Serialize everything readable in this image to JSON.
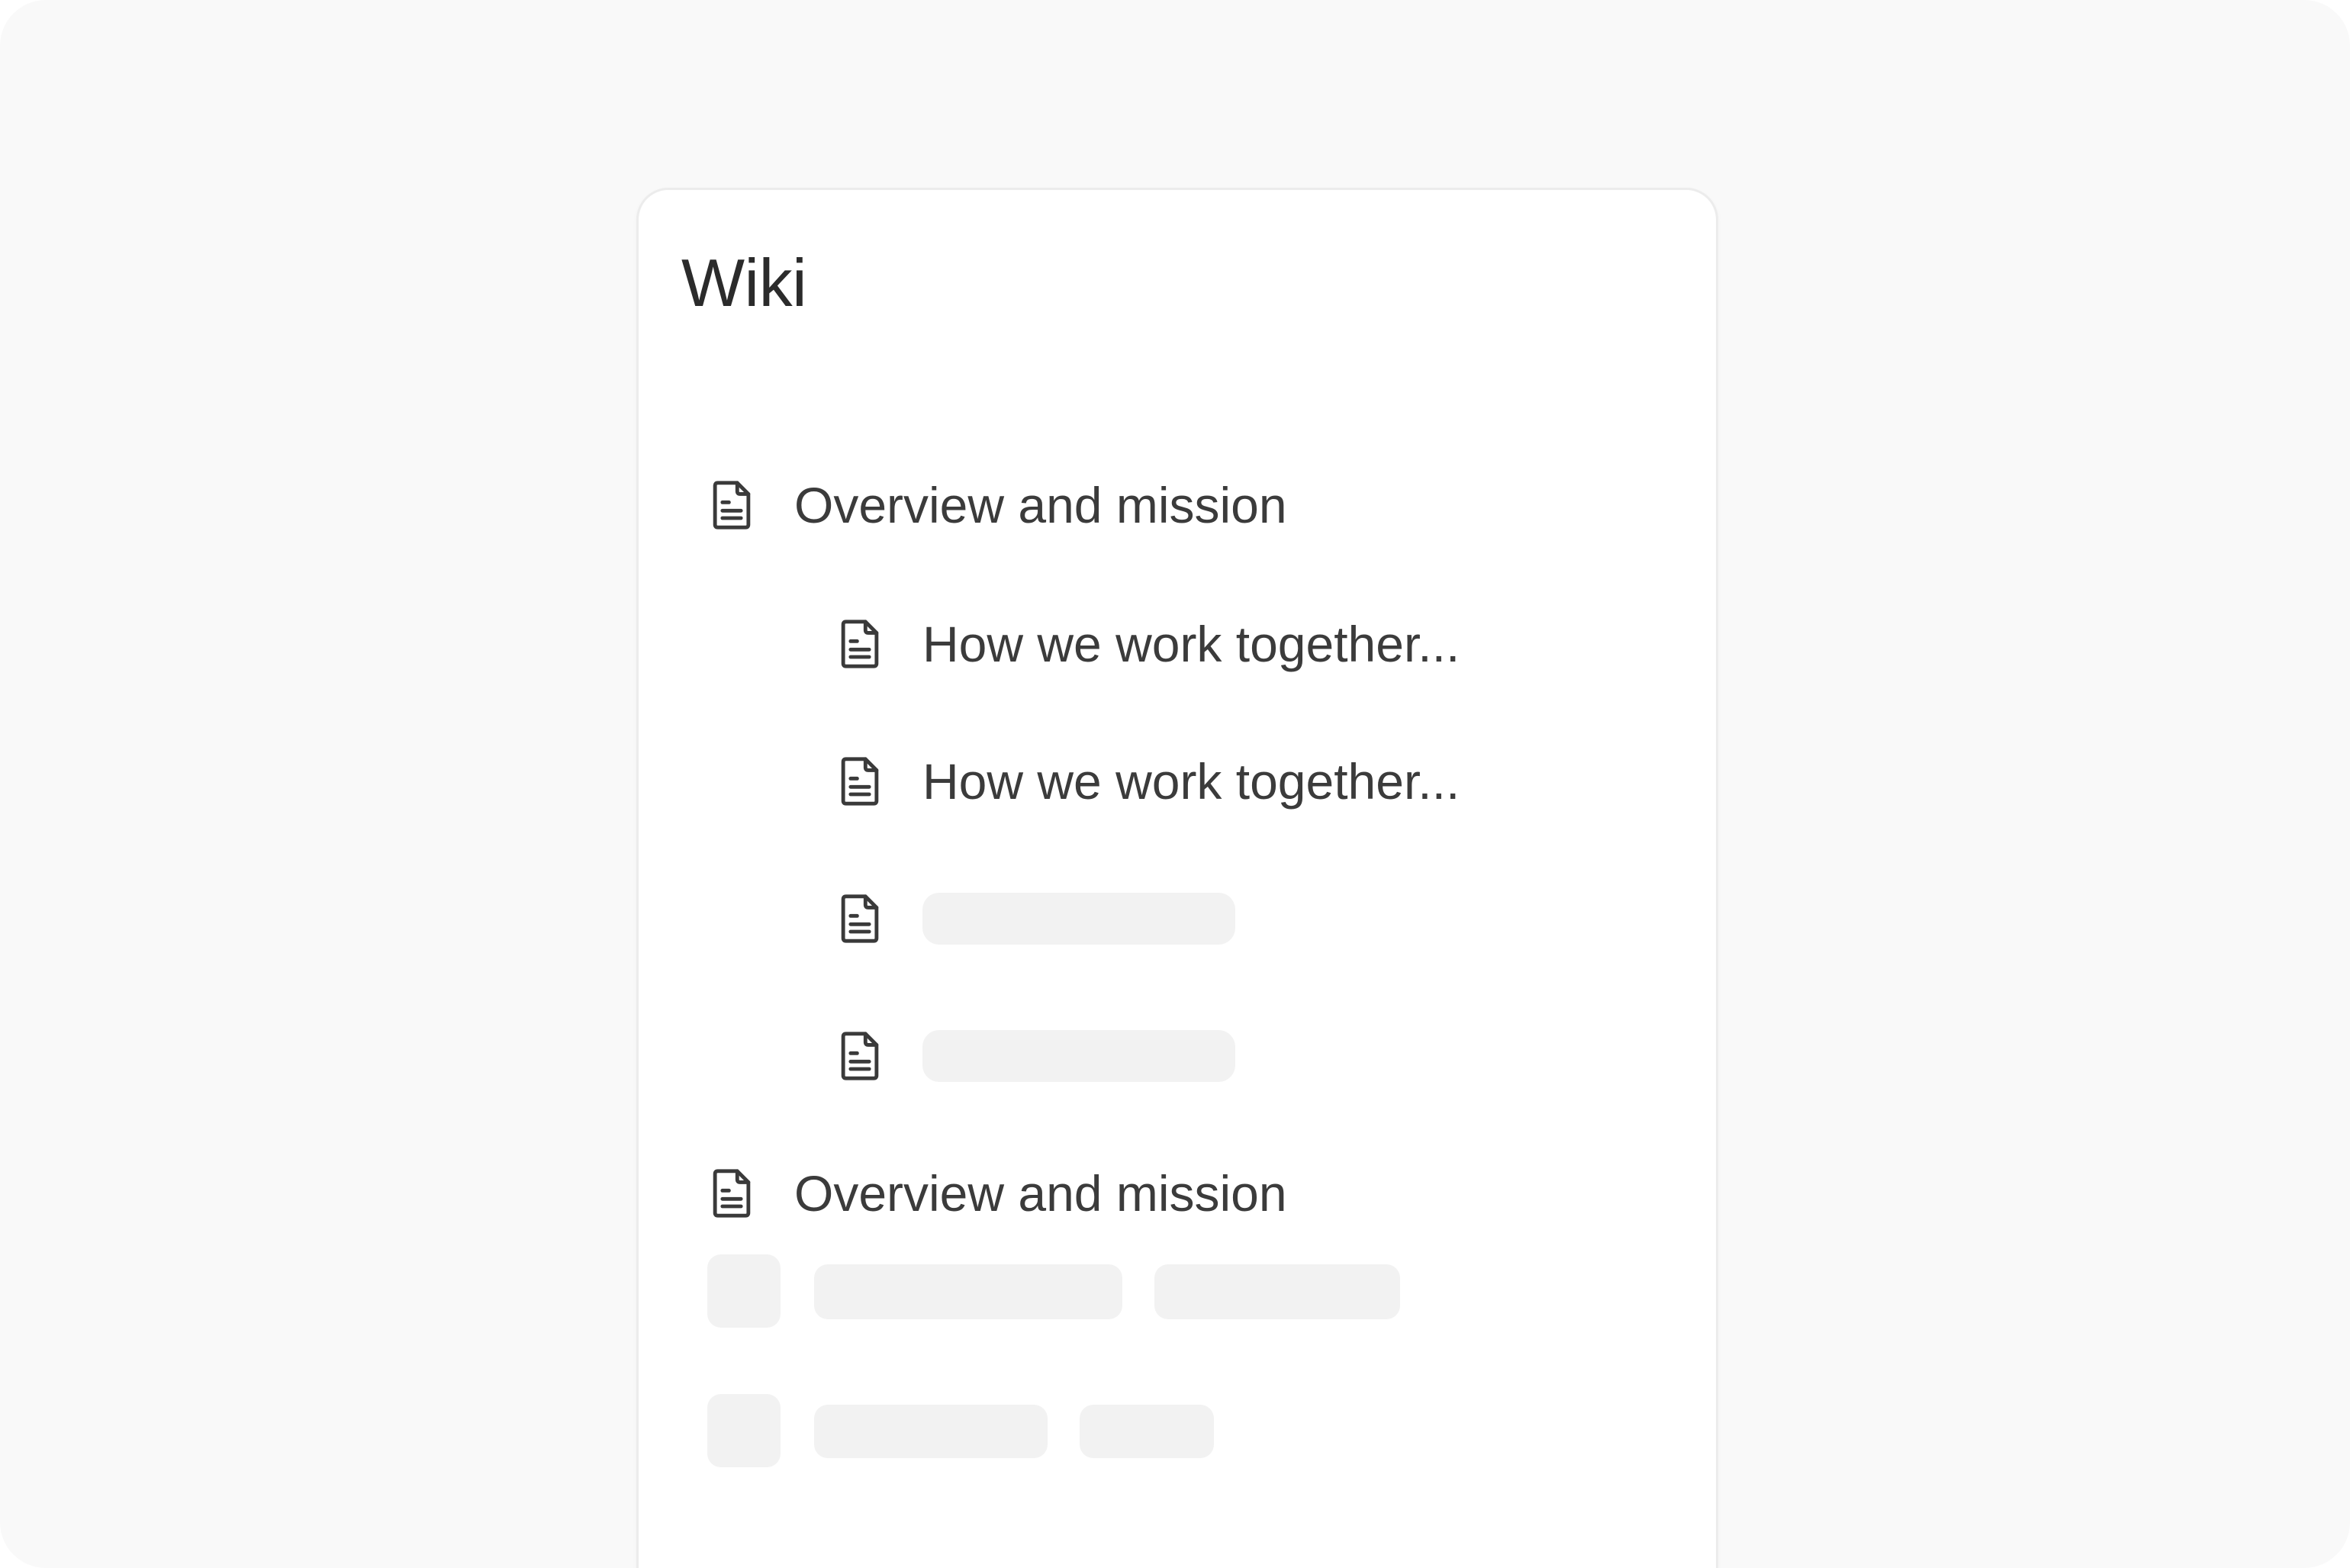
{
  "wiki": {
    "title": "Wiki",
    "items": [
      {
        "label": "Overview and mission",
        "icon": "document-icon",
        "level": 0
      },
      {
        "label": "How we work together...",
        "icon": "document-icon",
        "level": 1
      },
      {
        "label": "How we work together...",
        "icon": "document-icon",
        "level": 1
      },
      {
        "label": "",
        "icon": "document-icon",
        "level": 1,
        "loading": true
      },
      {
        "label": "",
        "icon": "document-icon",
        "level": 1,
        "loading": true
      },
      {
        "label": "Overview and mission",
        "icon": "document-icon",
        "level": 0
      }
    ],
    "loading_rows": 2
  },
  "colors": {
    "page_background": "#f9f9f9",
    "card_background": "#ffffff",
    "card_border": "#ececec",
    "text": "#3b3b3b",
    "title_text": "#2b2b2b",
    "icon": "#3a3a3a",
    "skeleton": "#f2f2f2"
  }
}
